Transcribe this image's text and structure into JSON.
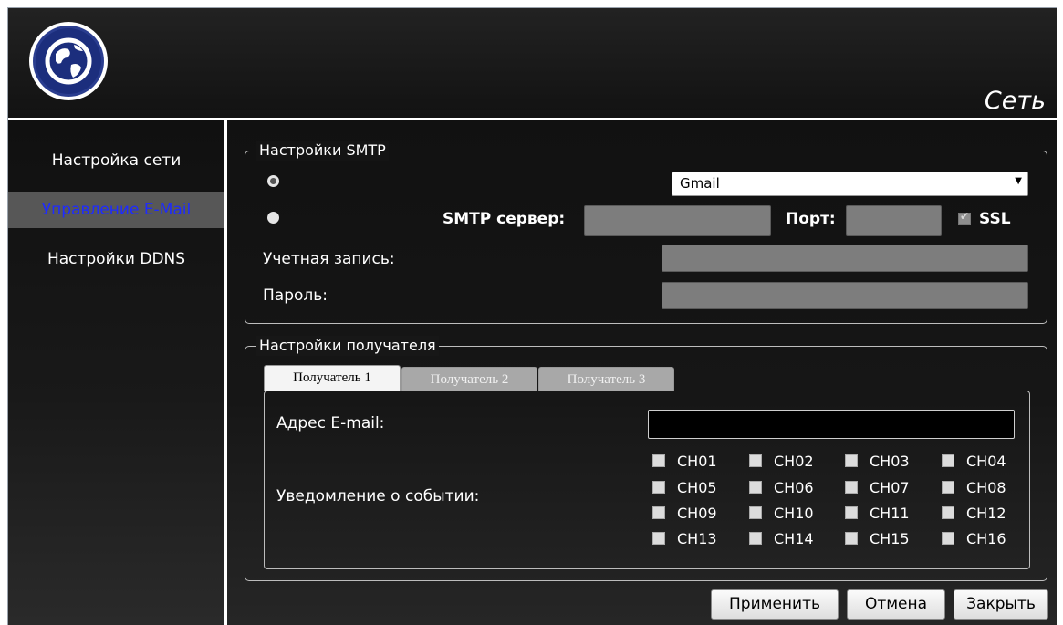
{
  "header": {
    "title": "Сеть",
    "logo_icon": "globe-icon"
  },
  "sidebar": {
    "items": [
      {
        "label": "Настройка сети"
      },
      {
        "label": "Управление E-Mail"
      },
      {
        "label": "Настройки DDNS"
      }
    ],
    "active_color": "#1e2bff"
  },
  "smtp": {
    "legend": "Настройки SMTP",
    "preset_value": "Gmail",
    "server_label": "SMTP сервер:",
    "server_value": "",
    "port_label": "Порт:",
    "port_value": "",
    "ssl_label": "SSL",
    "ssl_checked": true,
    "account_label": "Учетная запись:",
    "account_value": "",
    "password_label": "Пароль:",
    "password_value": ""
  },
  "recipients": {
    "legend": "Настройки получателя",
    "tabs": [
      "Получатель 1",
      "Получатель 2",
      "Получатель 3"
    ],
    "email_label": "Адрес E-mail:",
    "email_value": "",
    "event_label": "Уведомление о событии:",
    "channels": [
      "CH01",
      "CH02",
      "CH03",
      "CH04",
      "CH05",
      "CH06",
      "CH07",
      "CH08",
      "CH09",
      "CH10",
      "CH11",
      "CH12",
      "CH13",
      "CH14",
      "CH15",
      "CH16"
    ]
  },
  "buttons": {
    "apply": "Применить",
    "cancel": "Отмена",
    "close": "Закрыть"
  }
}
